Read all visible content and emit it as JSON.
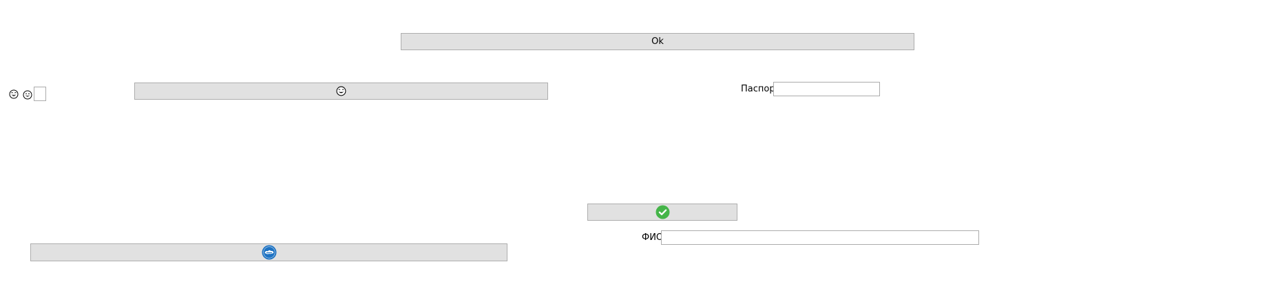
{
  "ok_button": {
    "label": "Ok"
  },
  "passport": {
    "label": "Паспорт",
    "value": "",
    "placeholder": ""
  },
  "fio": {
    "label": "ФИО",
    "value": "",
    "placeholder": ""
  },
  "small_input": {
    "value": ""
  },
  "icons": {
    "left_emoji_1": "grinning-face-with-sweat-icon",
    "left_emoji_2": "grinning-face-icon",
    "emoji_button": "grinning-face-with-sweat-icon",
    "check_button": "green-check-circle-icon",
    "blue_button": "blue-badge-icon"
  },
  "colors": {
    "button_bg": "#e1e1e1",
    "button_border": "#adadad",
    "check_green": "#45b549",
    "badge_blue": "#1d72c2"
  }
}
